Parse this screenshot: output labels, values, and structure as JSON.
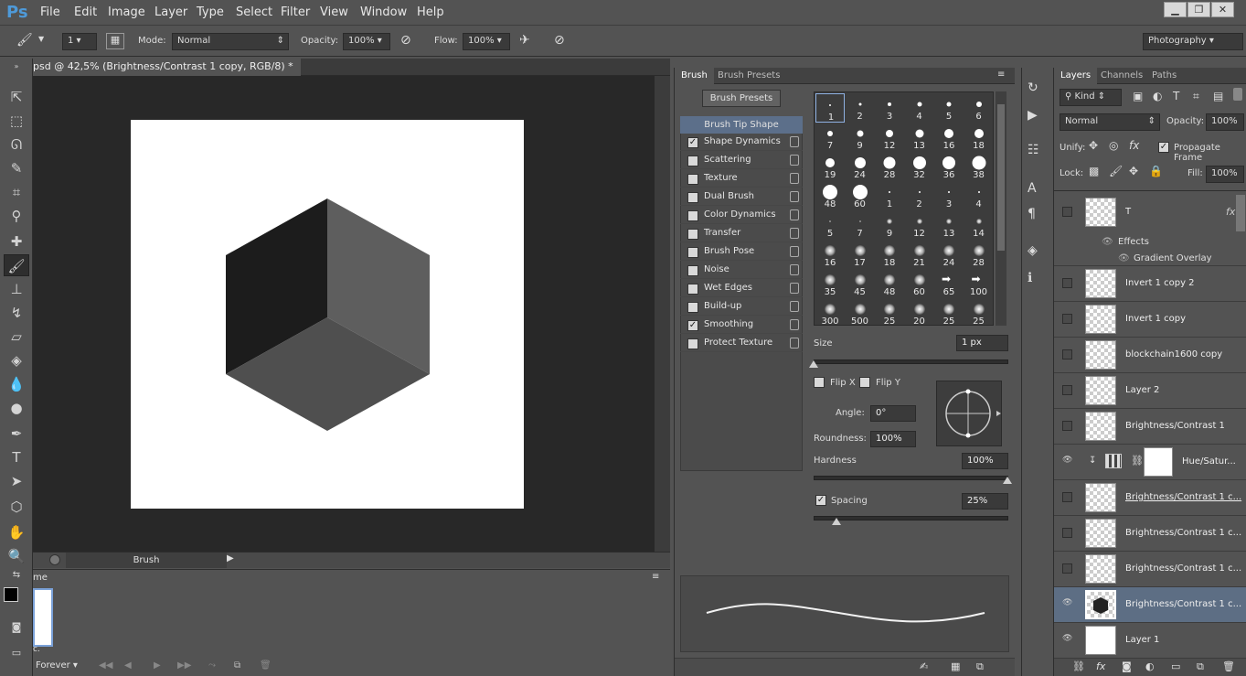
{
  "app": {
    "logo": "Ps"
  },
  "menu": [
    "File",
    "Edit",
    "Image",
    "Layer",
    "Type",
    "Select",
    "Filter",
    "View",
    "Window",
    "Help"
  ],
  "options": {
    "brush_size": "1",
    "mode_label": "Mode:",
    "mode_value": "Normal",
    "opacity_label": "Opacity:",
    "opacity_value": "100%",
    "flow_label": "Flow:",
    "flow_value": "100%",
    "workspace": "Photography"
  },
  "document": {
    "tab_title": "psd @ 42,5% (Brightness/Contrast 1 copy, RGB/8) *",
    "status_label": "Brush"
  },
  "timeline": {
    "tab_label": "me",
    "loop_label": "Forever",
    "frame_label": "c."
  },
  "brush_panel": {
    "tabs": [
      "Brush",
      "Brush Presets"
    ],
    "presets_button": "Brush Presets",
    "header_item": "Brush Tip Shape",
    "options": [
      {
        "label": "Shape Dynamics",
        "checked": "✓"
      },
      {
        "label": "Scattering",
        "checked": ""
      },
      {
        "label": "Texture",
        "checked": ""
      },
      {
        "label": "Dual Brush",
        "checked": ""
      },
      {
        "label": "Color Dynamics",
        "checked": ""
      },
      {
        "label": "Transfer",
        "checked": ""
      },
      {
        "label": "Brush Pose",
        "checked": ""
      },
      {
        "label": "Noise",
        "checked": ""
      },
      {
        "label": "Wet Edges",
        "checked": ""
      },
      {
        "label": "Build-up",
        "checked": ""
      },
      {
        "label": "Smoothing",
        "checked": "✓"
      },
      {
        "label": "Protect Texture",
        "checked": ""
      }
    ],
    "tips": [
      "1",
      "2",
      "3",
      "4",
      "5",
      "6",
      "7",
      "9",
      "12",
      "13",
      "16",
      "18",
      "19",
      "24",
      "28",
      "32",
      "36",
      "38",
      "48",
      "60",
      "1",
      "2",
      "3",
      "4",
      "5",
      "7",
      "9",
      "12",
      "13",
      "14",
      "16",
      "17",
      "18",
      "21",
      "24",
      "28",
      "35",
      "45",
      "48",
      "60",
      "65",
      "100",
      "300",
      "500",
      "25",
      "20",
      "25",
      "25"
    ],
    "size_label": "Size",
    "size_value": "1 px",
    "flipx_label": "Flip X",
    "flipy_label": "Flip Y",
    "angle_label": "Angle:",
    "angle_value": "0°",
    "roundness_label": "Roundness:",
    "roundness_value": "100%",
    "hardness_label": "Hardness",
    "hardness_value": "100%",
    "spacing_label": "Spacing",
    "spacing_value": "25%",
    "spacing_checked": "✓"
  },
  "layers_panel": {
    "tabs": [
      "Layers",
      "Channels",
      "Paths"
    ],
    "kind_label": "Kind",
    "blend_mode": "Normal",
    "opacity_label": "Opacity:",
    "opacity_value": "100%",
    "unify_label": "Unify:",
    "propagate_label": "Propagate Frame",
    "lock_label": "Lock:",
    "fill_label": "Fill:",
    "fill_value": "100%",
    "fx_label": "fx",
    "effects_label": "Effects",
    "gradient_label": "Gradient Overlay",
    "layers": [
      {
        "name": "T"
      },
      {
        "name": "Invert 1 copy 2"
      },
      {
        "name": "Invert 1 copy"
      },
      {
        "name": "blockchain1600 copy"
      },
      {
        "name": "Layer 2"
      },
      {
        "name": "Brightness/Contrast 1"
      },
      {
        "name": "Hue/Satur..."
      },
      {
        "name": "Brightness/Contrast 1 c..."
      },
      {
        "name": "Brightness/Contrast 1 c..."
      },
      {
        "name": "Brightness/Contrast 1 c..."
      },
      {
        "name": "Brightness/Contrast 1 c..."
      },
      {
        "name": "Layer 1"
      }
    ]
  },
  "colors": {
    "ui_bg": "#535353",
    "canvas_bg": "#282828",
    "selection": "#5d6e84",
    "ps_blue": "#4e9ad9"
  }
}
